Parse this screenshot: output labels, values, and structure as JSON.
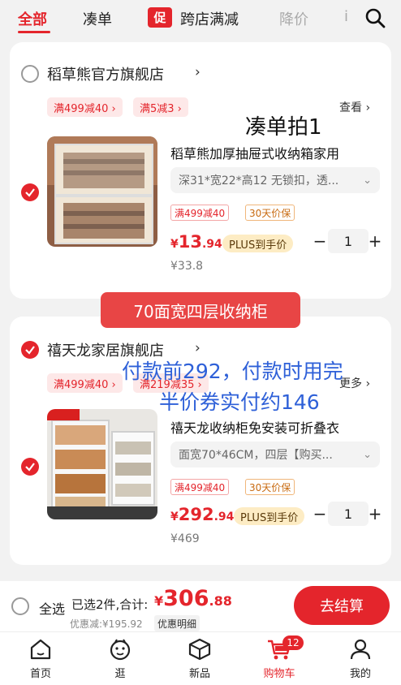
{
  "tabs": {
    "all": "全部",
    "bundle": "凑单",
    "promo_badge": "促",
    "cross_store": "跨店满减",
    "price_drop": "降价",
    "more_cut": "i"
  },
  "stores": [
    {
      "name": "稻草熊官方旗舰店",
      "checked": false,
      "coupons": [
        "满499减40 ›",
        "满5减3 ›"
      ],
      "more": "查看 ›",
      "product": {
        "title": "稻草熊加厚抽屉式收纳箱家用",
        "sku": "深31*宽22*高12 无锁扣，透...",
        "tags": [
          "满499减40",
          "30天价保"
        ],
        "price_currency": "¥",
        "price_int": "13",
        "price_dec": ".94",
        "plus_label": "PLUS到手价",
        "original_price": "¥33.8",
        "qty": "1"
      }
    },
    {
      "name": "禧天龙家居旗舰店",
      "checked": true,
      "coupons": [
        "满499减40 ›",
        "满219减35 ›"
      ],
      "more": "更多 ›",
      "product": {
        "title": "禧天龙收纳柜免安装可折叠衣",
        "sku": "面宽70*46CM，四层【购买...",
        "tags": [
          "满499减40",
          "30天价保"
        ],
        "price_currency": "¥",
        "price_int": "292",
        "price_dec": ".94",
        "plus_label": "PLUS到手价",
        "original_price": "¥469",
        "qty": "1"
      }
    }
  ],
  "overlays": {
    "note1": "凑单拍1",
    "banner": "70面宽四层收纳柜",
    "note2": "付款前292，付款时用完",
    "note3": "半价券实付约146"
  },
  "checkout": {
    "select_all": "全选",
    "selected": "已选2件,合计:",
    "total_currency": "¥",
    "total_int": "306",
    "total_dec": ".88",
    "discount": "优惠减:¥195.92",
    "discount_detail": "优惠明细",
    "checkout_button": "去结算"
  },
  "nav": {
    "home": "首页",
    "browse": "逛",
    "new": "新品",
    "cart": "购物车",
    "cart_count": "12",
    "mine": "我的"
  },
  "colors": {
    "accent": "#e4252c",
    "annotation_blue": "#2e60d8"
  }
}
